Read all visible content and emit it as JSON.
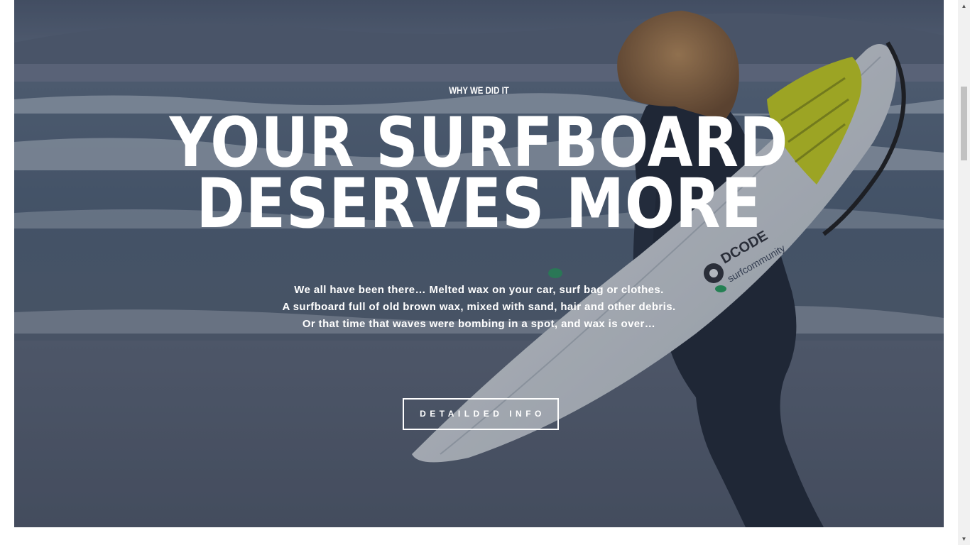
{
  "hero": {
    "eyebrow": "WHY WE DID IT",
    "headline_line1": "YOUR SURFBOARD",
    "headline_line2": "DESERVES MORE",
    "body_lines": [
      "We all have been there… Melted wax on your car, surf bag or clothes.",
      "A surfboard full of old brown wax, mixed with sand, hair and other debris.",
      "Or that time that waves were bombing in a spot, and wax is over…"
    ],
    "cta_label": "DETAILDED INFO",
    "board_brand": "DCODE",
    "board_sub": "surfcommunity"
  },
  "colors": {
    "overlay": "#283042",
    "text": "#ffffff",
    "wax_pad": "#c9d21a",
    "wetsuit": "#1c2433"
  },
  "scrollbar": {
    "up_icon": "scroll-up-arrow-icon",
    "down_icon": "scroll-down-arrow-icon"
  }
}
